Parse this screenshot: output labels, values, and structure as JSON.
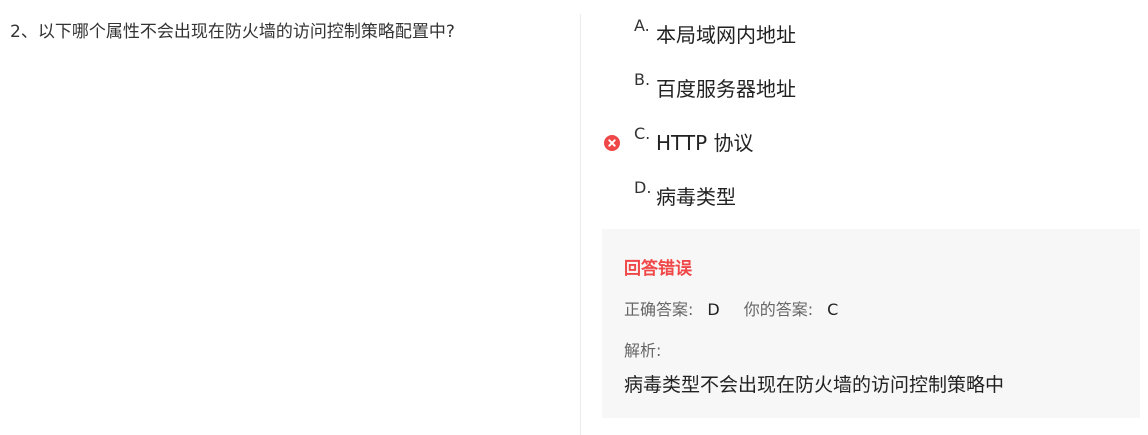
{
  "question": {
    "text": "2、以下哪个属性不会出现在防火墙的访问控制策略配置中?"
  },
  "options": [
    {
      "letter": "A.",
      "text": "本局域网内地址",
      "state": "none"
    },
    {
      "letter": "B.",
      "text": "百度服务器地址",
      "state": "none"
    },
    {
      "letter": "C.",
      "text": "HTTP 协议",
      "state": "wrong",
      "mark_icon": "wrong-circle-icon"
    },
    {
      "letter": "D.",
      "text": "病毒类型",
      "state": "none"
    }
  ],
  "result": {
    "status": "回答错误",
    "correct_label": "正确答案:",
    "correct_value": "D",
    "yours_label": "你的答案:",
    "yours_value": "C",
    "analysis_label": "解析:",
    "analysis_text": "病毒类型不会出现在防火墙的访问控制策略中"
  },
  "colors": {
    "error": "#f04848",
    "panel_bg": "#f7f7f7"
  }
}
